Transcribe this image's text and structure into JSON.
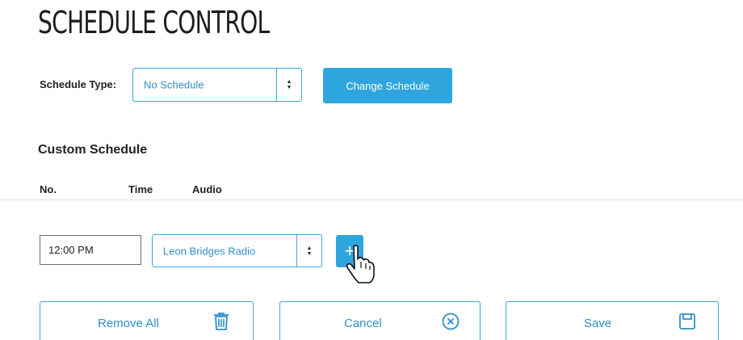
{
  "page": {
    "title": "SCHEDULE CONTROL"
  },
  "schedule_type": {
    "label": "Schedule Type:",
    "selected": "No Schedule",
    "change_button": "Change Schedule"
  },
  "custom_schedule": {
    "title": "Custom Schedule",
    "columns": [
      "No.",
      "Time",
      "Audio"
    ],
    "new_entry": {
      "time_value": "12:00 PM",
      "audio_selected": "Leon Bridges Radio",
      "add_button": "+"
    }
  },
  "actions": {
    "remove_all": "Remove All",
    "cancel": "Cancel",
    "save": "Save"
  },
  "colors": {
    "accent": "#2ea6dd",
    "border": "#3aa8df",
    "text_accent": "#2f8fc7"
  },
  "icons": [
    "select-caret-icon",
    "trash-icon",
    "close-circle-icon",
    "save-disk-icon",
    "hand-cursor-icon"
  ]
}
